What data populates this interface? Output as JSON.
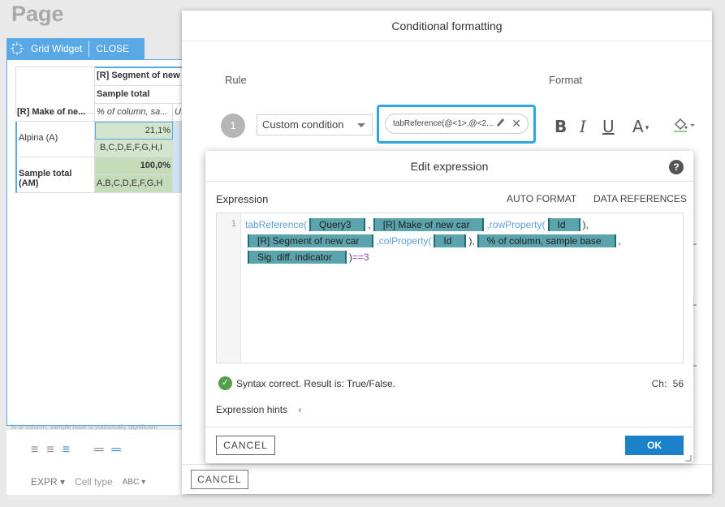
{
  "page": {
    "title": "Page"
  },
  "widget": {
    "name": "Grid Widget",
    "close": "CLOSE"
  },
  "grid": {
    "header_segment": "[R] Segment of new",
    "header_sample": "Sample total",
    "row_header": "[R] Make of ne...",
    "col_header": "% of column, sa...",
    "col_header2": "U",
    "rows": [
      {
        "label": "Alpina (A)",
        "value": "21,1%",
        "sig": "B,C,D,E,F,G,H,I"
      },
      {
        "label": "Sample total (AM)",
        "value": "100,0%",
        "sig": "A,B,C,D,E,F,G,H"
      }
    ],
    "footnote": "% of column, sample base is statistically significant"
  },
  "bg_toolbar": {
    "expr": "EXPR",
    "cell_type": "Cell type",
    "abc": "ABC"
  },
  "cf": {
    "title": "Conditional formatting",
    "rule_heading": "Rule",
    "format_heading": "Format",
    "rule_number": "1",
    "condition": "Custom condition",
    "expression_preview": "tabReference(@<1>,@<2...",
    "cancel": "CANCEL"
  },
  "edit_expression": {
    "title": "Edit expression",
    "expression_label": "Expression",
    "auto_format": "AUTO FORMAT",
    "data_references": "DATA REFERENCES",
    "line_number": "1",
    "code": {
      "fn_tabReference": "tabReference(",
      "tok_query": "Query3",
      "tok_make": "[R] Make of new car",
      "fn_rowProperty": ",rowProperty(",
      "tok_id1": "Id",
      "close1": "),",
      "tok_segment": "[R] Segment of new car",
      "fn_colProperty": ",colProperty(",
      "tok_id2": "Id",
      "close2": "),",
      "tok_column": "% of column, sample base",
      "comma": ",",
      "tok_sig": "Sig. diff. indicator",
      "close3": ")",
      "op_eq": "==3"
    },
    "status": "Syntax correct. Result is: True/False.",
    "char_label": "Ch:",
    "char_count": "56",
    "hints": "Expression hints",
    "cancel": "CANCEL",
    "ok": "OK"
  }
}
